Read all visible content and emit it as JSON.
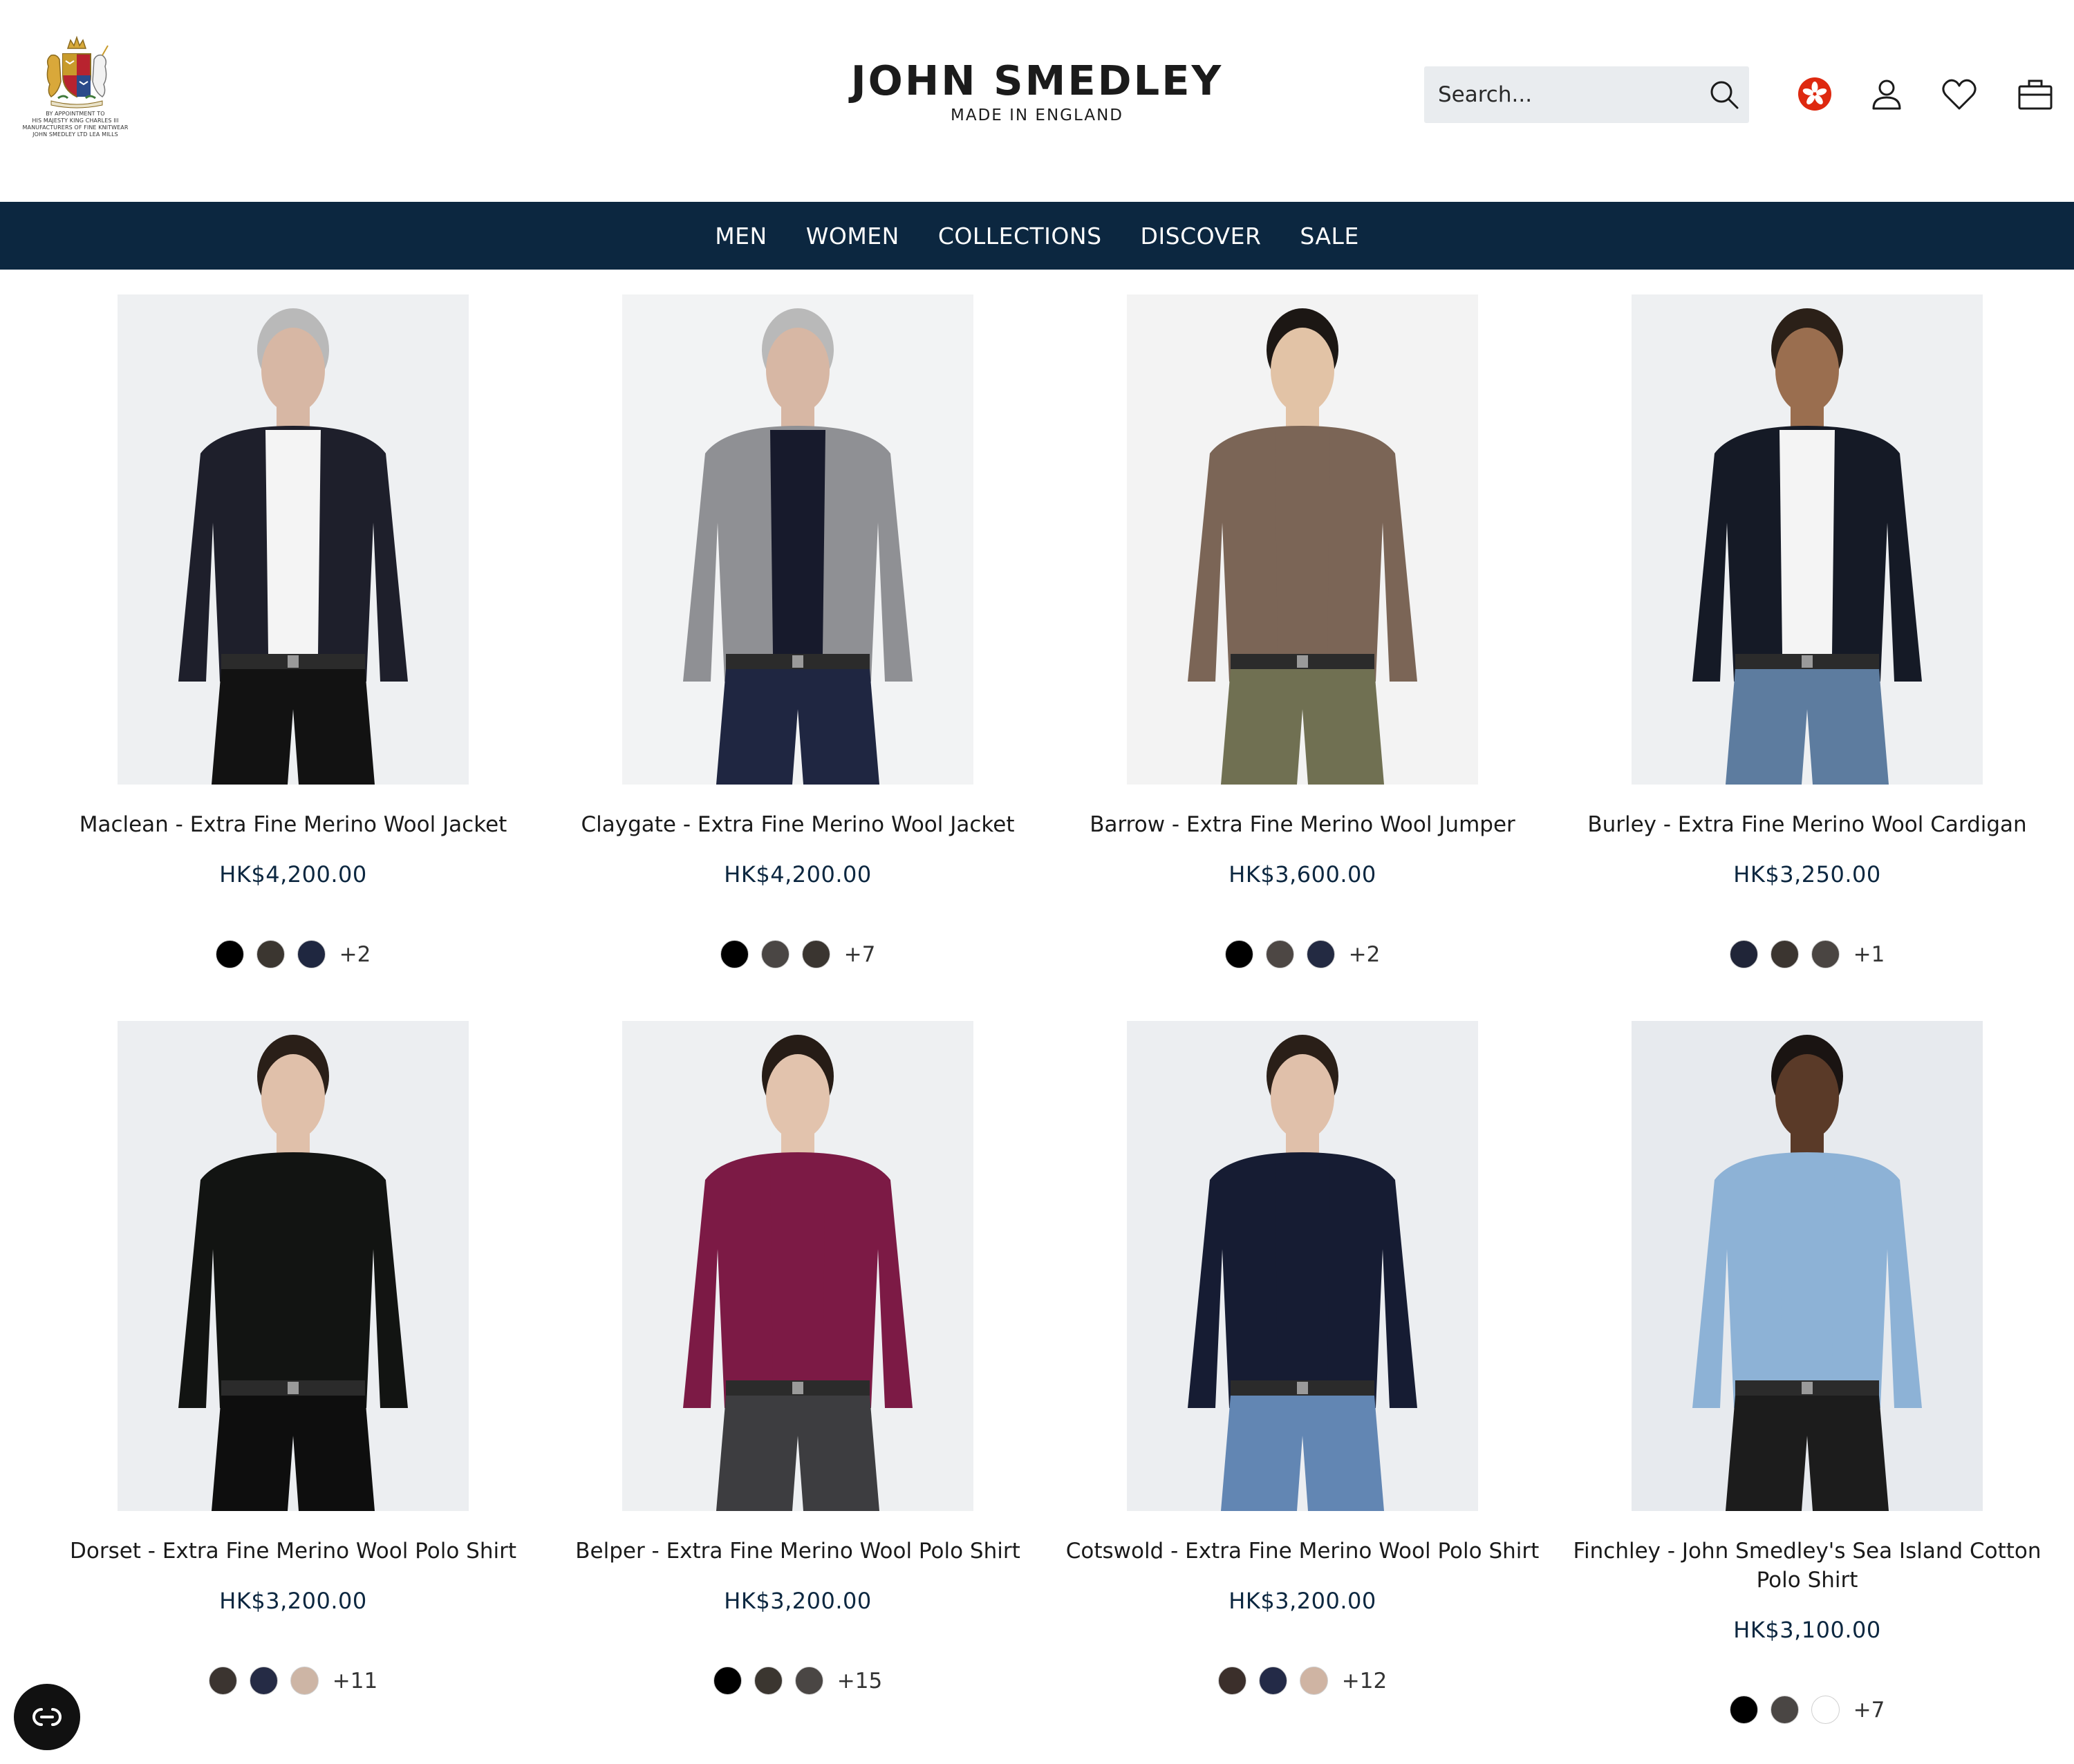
{
  "warrant": {
    "lines": [
      "BY APPOINTMENT TO",
      "HIS MAJESTY KING CHARLES III",
      "MANUFACTURERS OF FINE KNITWEAR",
      "JOHN SMEDLEY LTD LEA MILLS"
    ]
  },
  "brand": {
    "name": "JOHN SMEDLEY",
    "tagline": "MADE IN ENGLAND"
  },
  "search": {
    "placeholder": "Search...",
    "icon": "search-icon"
  },
  "utility": {
    "flag_icon": "hong-kong-flag-icon",
    "account_icon": "user-icon",
    "wishlist_icon": "heart-icon",
    "bag_icon": "bag-icon"
  },
  "nav": {
    "items": [
      {
        "label": "MEN"
      },
      {
        "label": "WOMEN"
      },
      {
        "label": "COLLECTIONS"
      },
      {
        "label": "DISCOVER"
      },
      {
        "label": "SALE"
      }
    ]
  },
  "products": [
    {
      "title": "Maclean - Extra Fine Merino Wool Jacket",
      "price": "HK$4,200.00",
      "swatches": [
        "#000000",
        "#3b3630",
        "#1f2740"
      ],
      "more": "+2",
      "image": {
        "bg": "#eef0f2",
        "top": "#1e1f2b",
        "inner": "#f4f4f4",
        "bottom": "#121212",
        "skin": "#d7b7a4",
        "hair": "#b9b9b9"
      }
    },
    {
      "title": "Claygate - Extra Fine Merino Wool Jacket",
      "price": "HK$4,200.00",
      "swatches": [
        "#000000",
        "#4a4644",
        "#3a3530"
      ],
      "more": "+7",
      "image": {
        "bg": "#f2f3f4",
        "top": "#8f9094",
        "inner": "#171a2c",
        "bottom": "#1f2641",
        "skin": "#d7b7a4",
        "hair": "#b9b9b9"
      }
    },
    {
      "title": "Barrow - Extra Fine Merino Wool Jumper",
      "price": "HK$3,600.00",
      "swatches": [
        "#000000",
        "#4d4744",
        "#232a42"
      ],
      "more": "+2",
      "image": {
        "bg": "#f3f3f3",
        "top": "#7b6556",
        "inner": "#7b6556",
        "bottom": "#707052",
        "skin": "#e2c3a6",
        "hair": "#1c1714"
      }
    },
    {
      "title": "Burley - Extra Fine Merino Wool Cardigan",
      "price": "HK$3,250.00",
      "swatches": [
        "#202538",
        "#3b3530",
        "#4a4542"
      ],
      "more": "+1",
      "image": {
        "bg": "#eef0f2",
        "top": "#151a26",
        "inner": "#f4f4f4",
        "bottom": "#5d7c9f",
        "skin": "#9a6e4f",
        "hair": "#2b2018"
      }
    },
    {
      "title": "Dorset - Extra Fine Merino Wool Polo Shirt",
      "price": "HK$3,200.00",
      "swatches": [
        "#3b3430",
        "#252b45",
        "#cdb5a5"
      ],
      "more": "+11",
      "image": {
        "bg": "#eceef1",
        "top": "#121412",
        "inner": "#121412",
        "bottom": "#0e0e0e",
        "skin": "#e0c0aa",
        "hair": "#2a1f18"
      }
    },
    {
      "title": "Belper - Extra Fine Merino Wool Polo Shirt",
      "price": "HK$3,200.00",
      "swatches": [
        "#000000",
        "#3b3630",
        "#4a4644"
      ],
      "more": "+15",
      "image": {
        "bg": "#eef0f2",
        "top": "#7c1a45",
        "inner": "#7c1a45",
        "bottom": "#3d3d40",
        "skin": "#e2c3ad",
        "hair": "#261c16"
      }
    },
    {
      "title": "Cotswold - Extra Fine Merino Wool Polo Shirt",
      "price": "HK$3,200.00",
      "swatches": [
        "#3b2f2b",
        "#232a47",
        "#cfb4a3"
      ],
      "more": "+12",
      "image": {
        "bg": "#eceef1",
        "top": "#161c33",
        "inner": "#161c33",
        "bottom": "#6286b3",
        "skin": "#e0c0aa",
        "hair": "#2a1f18"
      }
    },
    {
      "title": "Finchley - John Smedley's Sea Island Cotton Polo Shirt",
      "price": "HK$3,100.00",
      "swatches": [
        "#000000",
        "#4a4644",
        "#ffffff"
      ],
      "more": "+7",
      "image": {
        "bg": "#e7eaee",
        "top": "#8db2d6",
        "inner": "#8db2d6",
        "bottom": "#1c1c1c",
        "skin": "#5a3a28",
        "hair": "#1a1412"
      }
    }
  ],
  "accessibility": {
    "icon": "accessibility-toggle-icon"
  }
}
